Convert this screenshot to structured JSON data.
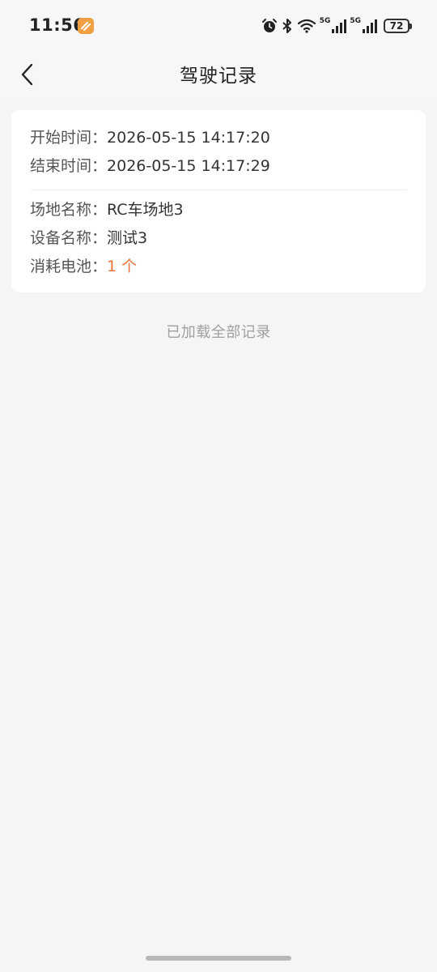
{
  "status_bar": {
    "time": "11:56",
    "network_1": "5G",
    "network_2": "5G",
    "battery": "72",
    "icons": [
      "app-badge-icon",
      "alarm-icon",
      "bluetooth-icon",
      "wifi-icon",
      "signal-icon",
      "battery-icon"
    ]
  },
  "nav": {
    "back_icon": "chevron-left-icon",
    "title": "驾驶记录"
  },
  "record": {
    "start_label": "开始时间：",
    "start_value": "2026-05-15 14:17:20",
    "end_label": "结束时间：",
    "end_value": "2026-05-15 14:17:29",
    "venue_label": "场地名称：",
    "venue_value": "RC车场地3",
    "device_label": "设备名称：",
    "device_value": "测试3",
    "battery_label": "消耗电池：",
    "battery_value": "1 个"
  },
  "footer": {
    "text": "已加载全部记录"
  },
  "colors": {
    "accent": "#e8763a",
    "background": "#f5f5f5",
    "card": "#ffffff",
    "app_badge": "#f0a043"
  }
}
